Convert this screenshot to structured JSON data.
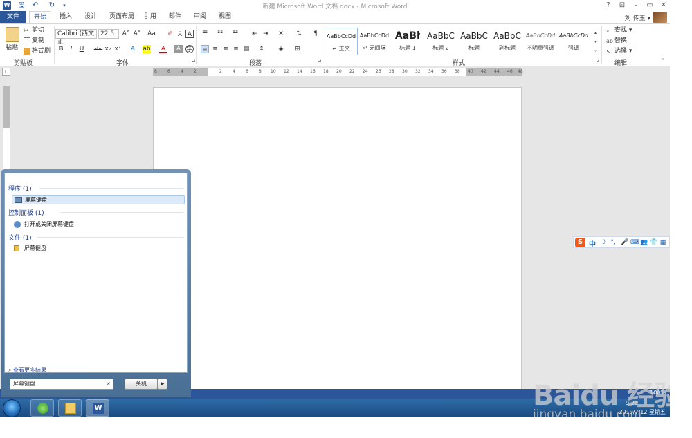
{
  "titlebar": {
    "doc_title": "新建 Microsoft Word 文档.docx - Microsoft Word",
    "help": "?",
    "restore_ribbon": "⊡",
    "minimize": "–",
    "maximize": "▭",
    "close": "✕",
    "qat_save": "🖫",
    "qat_undo": "↶",
    "qat_redo": "↻",
    "qat_customize": "▾",
    "app_icon_letter": "W"
  },
  "tabs": {
    "file": "文件",
    "items": [
      "开始",
      "插入",
      "设计",
      "页面布局",
      "引用",
      "邮件",
      "审阅",
      "视图"
    ],
    "user": "刘 传玉 ▾"
  },
  "ribbon": {
    "clipboard": {
      "label": "剪贴板",
      "paste": "粘贴",
      "cut": "剪切",
      "copy": "复制",
      "format_painter": "格式刷"
    },
    "font": {
      "label": "字体",
      "font_name": "Calibri (西文正",
      "font_size": "22.5",
      "grow": "A˄",
      "shrink": "A˅",
      "case": "Aa",
      "bold": "B",
      "italic": "I",
      "underline": "U",
      "strikethrough": "abc",
      "subscript": "x₂",
      "superscript": "x²"
    },
    "paragraph": {
      "label": "段落"
    },
    "styles": {
      "label": "样式",
      "items": [
        {
          "sample": "AaBbCcDd",
          "name": "↵ 正文"
        },
        {
          "sample": "AaBbCcDd",
          "name": "↵ 无间隔"
        },
        {
          "sample": "AaBł",
          "name": "标题 1"
        },
        {
          "sample": "AaBbC",
          "name": "标题 2"
        },
        {
          "sample": "AaBbC",
          "name": "标题"
        },
        {
          "sample": "AaBbC",
          "name": "副标题"
        },
        {
          "sample": "AaBbCcDd",
          "name": "不明显强调"
        },
        {
          "sample": "AaBbCcDd",
          "name": "强调"
        }
      ]
    },
    "editing": {
      "label": "编辑",
      "find": "查找 ▾",
      "replace": "替换",
      "select": "选择 ▾"
    }
  },
  "ruler": {
    "corner": "L",
    "ticks": [
      "8",
      "6",
      "4",
      "2",
      "",
      "2",
      "4",
      "6",
      "8",
      "10",
      "12",
      "14",
      "16",
      "18",
      "20",
      "22",
      "24",
      "26",
      "28",
      "30",
      "32",
      "34",
      "36",
      "38",
      "40",
      "42",
      "44",
      "46",
      "48"
    ]
  },
  "start_menu": {
    "section_programs": "程序 (1)",
    "program_item": "屏幕键盘",
    "section_control_panel": "控制面板 (1)",
    "control_panel_item": "打开或关闭屏幕键盘",
    "section_files": "文件 (1)",
    "file_item": "屏幕键盘",
    "see_more": "查看更多结果",
    "search_value": "屏幕键盘",
    "clear": "×",
    "shutdown": "关机",
    "shutdown_arrow": "▶"
  },
  "statusbar": {
    "zoom": "100%"
  },
  "taskbar": {
    "time": "9:25",
    "date": "2019/7/12 星期五"
  },
  "ime": {
    "cn": "中",
    "icons": [
      "☽",
      "°,",
      "🎤",
      "⌨",
      "👥",
      "👕",
      "▦"
    ]
  },
  "watermark": {
    "main": "Baidu 经验",
    "sub": "jingyan.baidu.com"
  },
  "colors": {
    "word_blue": "#2b579a",
    "taskbar": "#1a4a80"
  }
}
